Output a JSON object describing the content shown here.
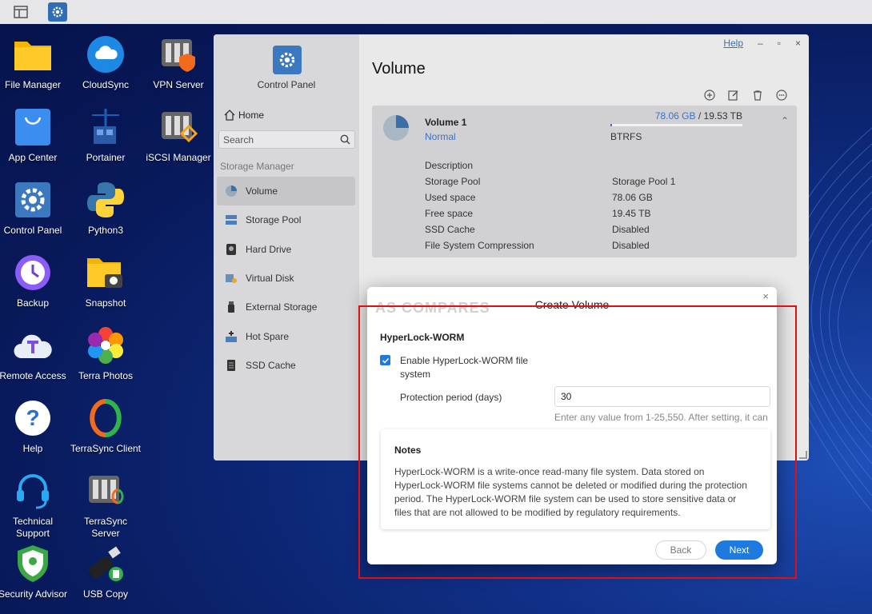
{
  "desktop": {
    "icons": [
      {
        "label": "File Manager",
        "icon": "folder-icon"
      },
      {
        "label": "CloudSync",
        "icon": "cloud-sync-icon"
      },
      {
        "label": "VPN Server",
        "icon": "vpn-server-icon"
      },
      {
        "label": "App Center",
        "icon": "app-center-bag-icon"
      },
      {
        "label": "Portainer",
        "icon": "portainer-icon"
      },
      {
        "label": "iSCSI Manager",
        "icon": "iscsi-manager-icon"
      },
      {
        "label": "Control Panel",
        "icon": "gear-icon"
      },
      {
        "label": "Python3",
        "icon": "python-icon"
      },
      {
        "label": "Backup",
        "icon": "backup-clock-icon"
      },
      {
        "label": "Snapshot",
        "icon": "snapshot-folder-camera-icon"
      },
      {
        "label": "Remote Access",
        "icon": "remote-access-cloud-icon"
      },
      {
        "label": "Terra Photos",
        "icon": "terra-photos-flower-icon"
      },
      {
        "label": "Help",
        "icon": "help-question-icon"
      },
      {
        "label": "TerraSync Client",
        "icon": "terrasync-client-icon"
      },
      {
        "label": "Technical Support",
        "icon": "headset-icon"
      },
      {
        "label": "TerraSync Server",
        "icon": "terrasync-server-icon"
      },
      {
        "label": "Security Advisor",
        "icon": "security-shield-icon"
      },
      {
        "label": "USB Copy",
        "icon": "usb-copy-icon"
      }
    ]
  },
  "control_panel": {
    "app_title": "Control Panel",
    "home_label": "Home",
    "search_placeholder": "Search",
    "section_label": "Storage Manager",
    "nav": [
      {
        "label": "Volume",
        "icon": "volume-pie-icon",
        "active": true
      },
      {
        "label": "Storage Pool",
        "icon": "storage-pool-icon"
      },
      {
        "label": "Hard Drive",
        "icon": "hard-drive-icon"
      },
      {
        "label": "Virtual Disk",
        "icon": "virtual-disk-icon"
      },
      {
        "label": "External Storage",
        "icon": "external-storage-icon"
      },
      {
        "label": "Hot Spare",
        "icon": "hot-spare-icon"
      },
      {
        "label": "SSD Cache",
        "icon": "ssd-cache-icon"
      }
    ],
    "help_label": "Help",
    "page_title": "Volume",
    "volume": {
      "name": "Volume 1",
      "status": "Normal",
      "used": "78.06 GB",
      "total": "19.53 TB",
      "usage_fraction": 0.004,
      "filesystem": "BTRFS",
      "rows": [
        {
          "key": "Description",
          "value": ""
        },
        {
          "key": "Storage Pool",
          "value": "Storage Pool 1"
        },
        {
          "key": "Used space",
          "value": "78.06 GB"
        },
        {
          "key": "Free space",
          "value": "19.45 TB"
        },
        {
          "key": "SSD Cache",
          "value": "Disabled"
        },
        {
          "key": "File System Compression",
          "value": "Disabled"
        }
      ]
    }
  },
  "dialog": {
    "title": "Create Volume",
    "watermark": "AS COMPARES",
    "section": "HyperLock-WORM",
    "checkbox_label": "Enable HyperLock-WORM file system",
    "checkbox_checked": true,
    "period_label": "Protection period (days)",
    "period_value": "30",
    "hint": "Enter any value from 1-25,550. After setting, it can",
    "notes_title": "Notes",
    "notes_text": "HyperLock-WORM is a write-once read-many file system. Data stored on HyperLock-WORM file systems cannot be deleted or modified during the protection period. The HyperLock-WORM file system can be used to store sensitive data or files that are not allowed to be modified by regulatory requirements.",
    "back_label": "Back",
    "next_label": "Next"
  },
  "colors": {
    "accent": "#1f7ae0",
    "highlight_box": "#e01010"
  }
}
